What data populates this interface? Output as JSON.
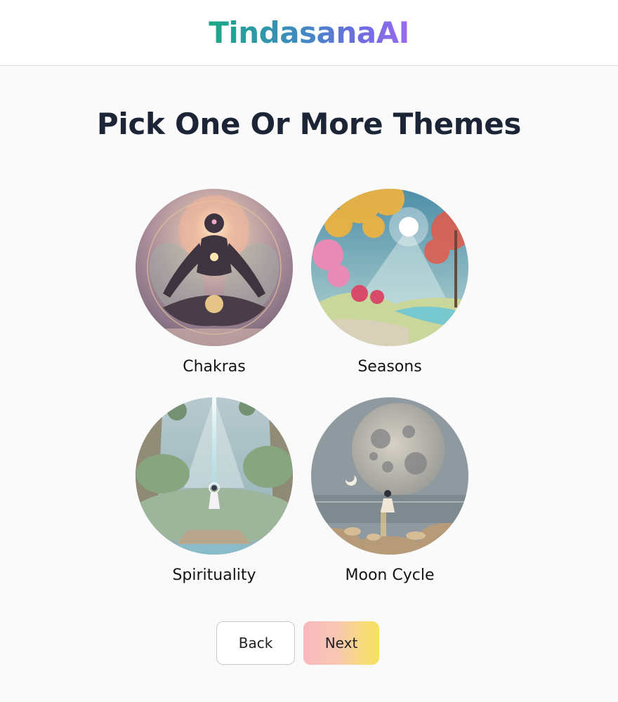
{
  "header": {
    "logo": "TindasanaAI"
  },
  "main": {
    "title": "Pick One Or More Themes",
    "themes": [
      {
        "label": "Chakras",
        "image": "meditating-figure-chakras"
      },
      {
        "label": "Seasons",
        "image": "autumn-landscape-sunrays"
      },
      {
        "label": "Spirituality",
        "image": "figure-under-light-beam"
      },
      {
        "label": "Moon Cycle",
        "image": "full-moon-over-water"
      }
    ]
  },
  "nav": {
    "back_label": "Back",
    "next_label": "Next"
  },
  "colors": {
    "title": "#1c2535",
    "logo_gradient_start": "#1aa987",
    "logo_gradient_end": "#9b6af0",
    "next_gradient_start": "#f9b8c0",
    "next_gradient_end": "#f5e060"
  }
}
